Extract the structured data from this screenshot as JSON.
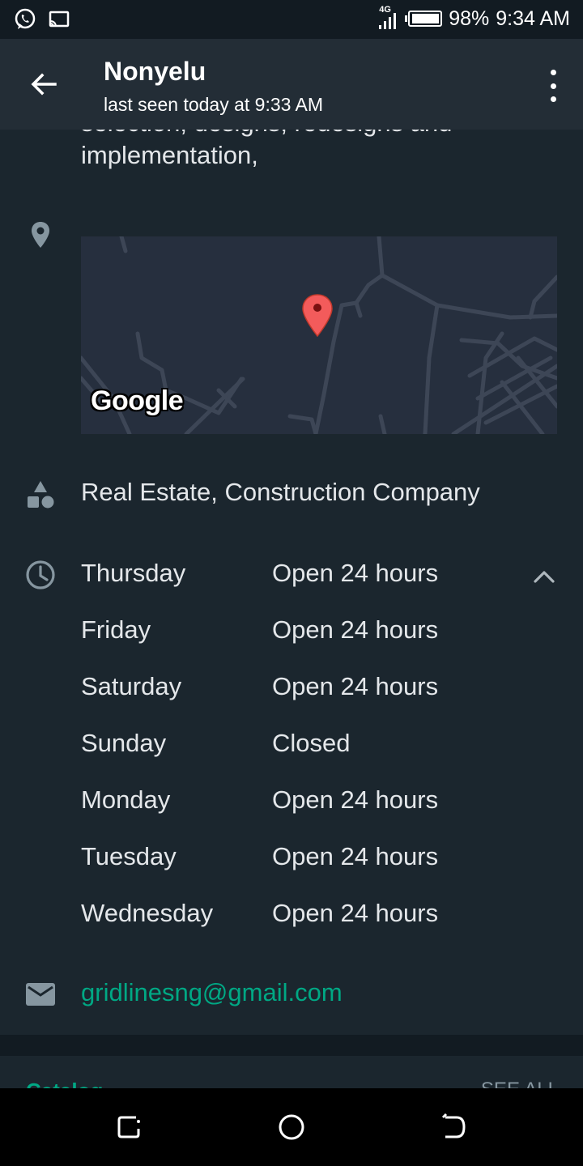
{
  "status_bar": {
    "network": "4G",
    "battery": "98%",
    "battery_level": 0.98,
    "time": "9:34 AM"
  },
  "header": {
    "name": "Nonyelu",
    "last_seen": "last seen today at 9:33 AM"
  },
  "business": {
    "description_cut": "selection, designs, redesigns and",
    "description_end": "implementation,",
    "map_logo": "Google",
    "category": "Real Estate, Construction Company",
    "hours": [
      {
        "day": "Thursday",
        "time": "Open 24 hours"
      },
      {
        "day": "Friday",
        "time": "Open 24 hours"
      },
      {
        "day": "Saturday",
        "time": "Open 24 hours"
      },
      {
        "day": "Sunday",
        "time": "Closed"
      },
      {
        "day": "Monday",
        "time": "Open 24 hours"
      },
      {
        "day": "Tuesday",
        "time": "Open 24 hours"
      },
      {
        "day": "Wednesday",
        "time": "Open 24 hours"
      }
    ],
    "email": "gridlinesng@gmail.com"
  },
  "next_section": {
    "title": "Catalog",
    "see_all": "SEE ALL"
  },
  "icons": {
    "back": "arrow-left-icon",
    "more": "more-vertical-icon",
    "location": "location-pin-icon",
    "category": "category-shapes-icon",
    "clock": "clock-icon",
    "mail": "mail-icon",
    "collapse": "chevron-up-icon",
    "map_marker": "map-marker-icon"
  },
  "colors": {
    "accent": "#00a884",
    "app_bar": "#232d36",
    "background": "#1b262e",
    "map_marker": "#f35b5b"
  }
}
